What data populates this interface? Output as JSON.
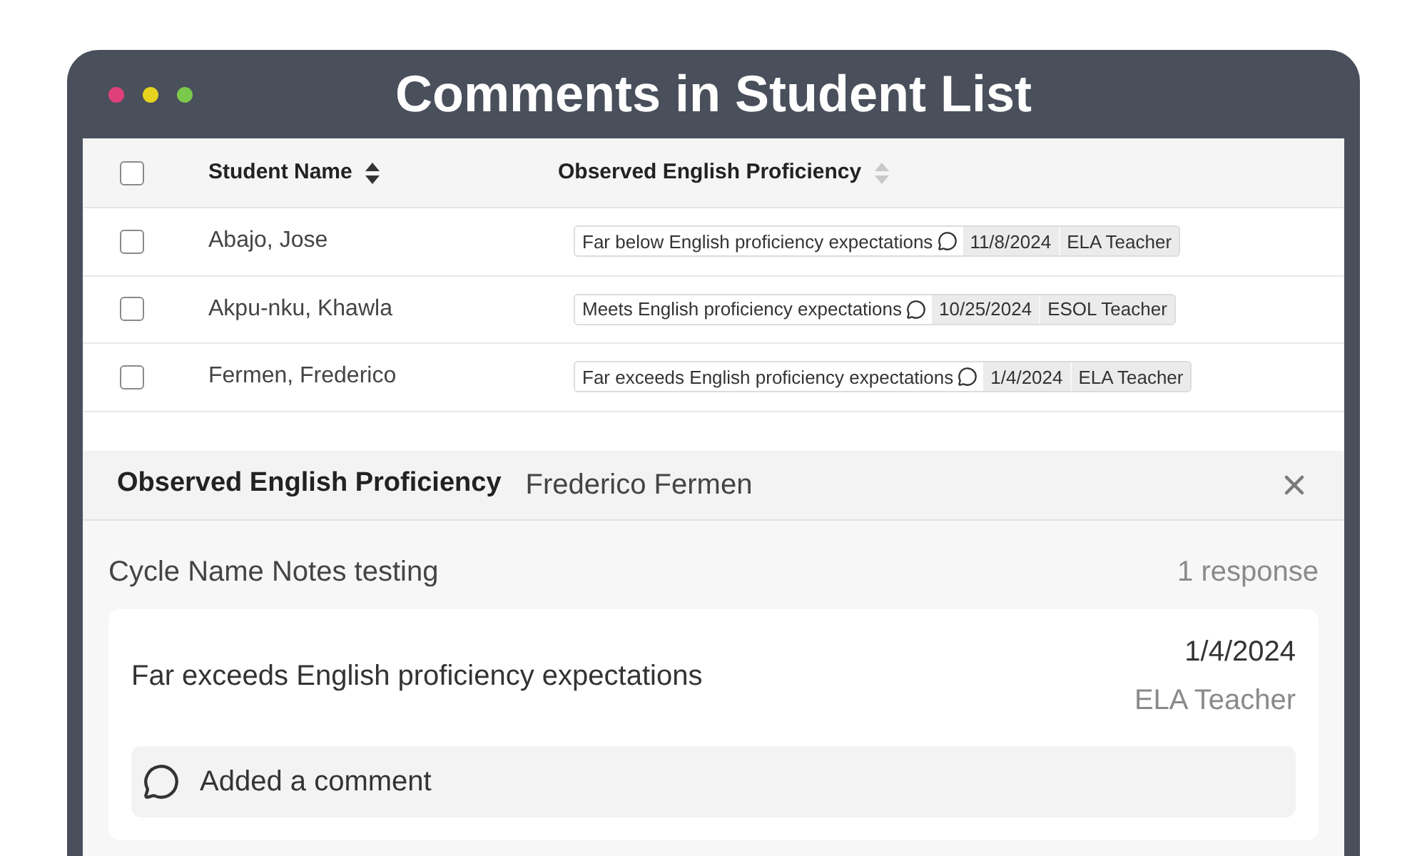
{
  "window": {
    "title": "Comments in Student List"
  },
  "table": {
    "select_all": {
      "checked": false
    },
    "columns": [
      {
        "label": "Student Name",
        "sort_active": true
      },
      {
        "label": "Observed English Proficiency",
        "sort_active": false
      }
    ],
    "rows": [
      {
        "checked": false,
        "name": "Abajo, Jose",
        "proficiency": {
          "text": "Far below English proficiency expectations",
          "date": "11/8/2024",
          "author": "ELA Teacher"
        }
      },
      {
        "checked": false,
        "name": "Akpu-nku, Khawla",
        "proficiency": {
          "text": "Meets English proficiency expectations",
          "date": "10/25/2024",
          "author": "ESOL Teacher"
        }
      },
      {
        "checked": false,
        "name": "Fermen, Frederico",
        "proficiency": {
          "text": "Far exceeds English proficiency expectations",
          "date": "1/4/2024",
          "author": "ELA Teacher"
        }
      }
    ]
  },
  "detail_panel": {
    "title": "Observed English Proficiency",
    "student": "Frederico Fermen",
    "cycle": "Cycle Name Notes testing",
    "response_count": "1 response",
    "responses": [
      {
        "text": "Far exceeds English proficiency expectations",
        "date": "1/4/2024",
        "author": "ELA Teacher",
        "comment": "Added a comment"
      }
    ]
  }
}
